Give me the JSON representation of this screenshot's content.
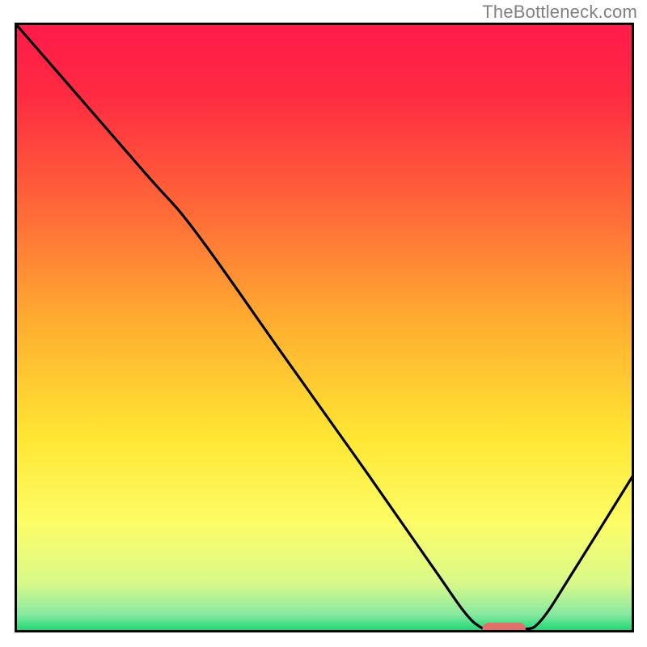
{
  "watermark": "TheBottleneck.com",
  "chart_data": {
    "type": "line",
    "title": "",
    "xlabel": "",
    "ylabel": "",
    "xlim": [
      0,
      100
    ],
    "ylim": [
      0,
      100
    ],
    "gradient_stops": [
      {
        "offset": 0.0,
        "color": "#ff1a4a"
      },
      {
        "offset": 0.12,
        "color": "#ff2b42"
      },
      {
        "offset": 0.3,
        "color": "#ff6638"
      },
      {
        "offset": 0.5,
        "color": "#ffb030"
      },
      {
        "offset": 0.68,
        "color": "#ffe633"
      },
      {
        "offset": 0.82,
        "color": "#fdfd66"
      },
      {
        "offset": 0.92,
        "color": "#d8f98a"
      },
      {
        "offset": 0.97,
        "color": "#88e9a0"
      },
      {
        "offset": 1.0,
        "color": "#14d46e"
      }
    ],
    "series": [
      {
        "name": "bottleneck-curve",
        "type": "path",
        "stroke": "#000000",
        "points": [
          {
            "x": 0.0,
            "y": 100.0
          },
          {
            "x": 20.5,
            "y": 76.0
          },
          {
            "x": 29.0,
            "y": 66.0
          },
          {
            "x": 43.0,
            "y": 46.0
          },
          {
            "x": 57.0,
            "y": 26.0
          },
          {
            "x": 68.0,
            "y": 10.0
          },
          {
            "x": 72.5,
            "y": 3.5
          },
          {
            "x": 75.0,
            "y": 1.0
          },
          {
            "x": 77.0,
            "y": 0.5
          },
          {
            "x": 82.0,
            "y": 0.5
          },
          {
            "x": 85.0,
            "y": 2.0
          },
          {
            "x": 90.5,
            "y": 10.5
          },
          {
            "x": 100.0,
            "y": 26.0
          }
        ]
      },
      {
        "name": "optimal-marker",
        "type": "capsule",
        "fill": "#e16f6a",
        "x_start": 75.5,
        "x_end": 82.5,
        "y": 0.5,
        "thickness_pct": 2.2
      }
    ],
    "frame": {
      "stroke": "#000000",
      "stroke_width_px": 6
    }
  }
}
